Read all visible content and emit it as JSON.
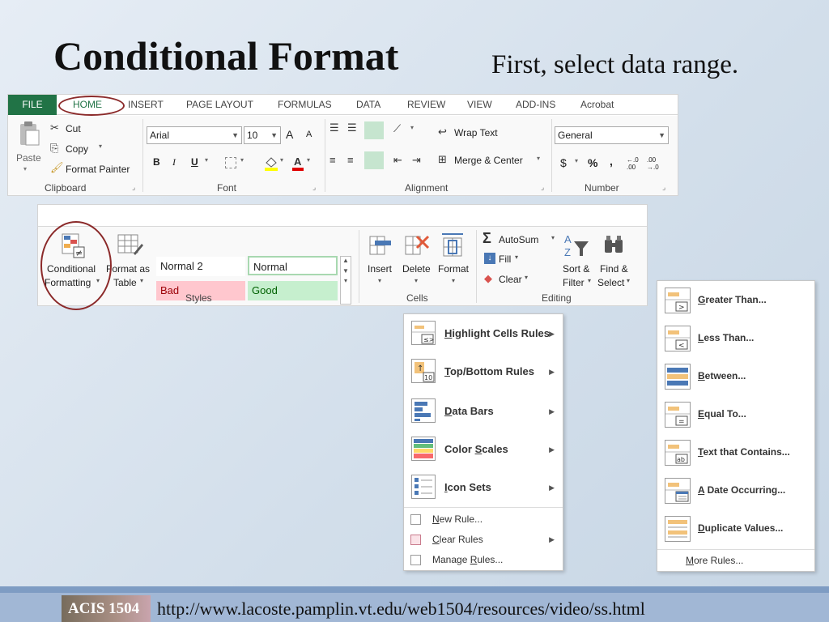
{
  "slide": {
    "title": "Conditional Format",
    "subtitle": "First, select data range."
  },
  "ribbon_top": {
    "tabs": [
      "FILE",
      "HOME",
      "INSERT",
      "PAGE LAYOUT",
      "FORMULAS",
      "DATA",
      "REVIEW",
      "VIEW",
      "ADD-INS",
      "Acrobat"
    ],
    "active_tab": "HOME",
    "clipboard": {
      "paste": "Paste",
      "cut": "Cut",
      "copy": "Copy",
      "format_painter": "Format Painter",
      "group": "Clipboard"
    },
    "font": {
      "name": "Arial",
      "size": "10",
      "bold": "B",
      "italic": "I",
      "underline": "U",
      "grow": "A",
      "shrink": "A",
      "group": "Font"
    },
    "alignment": {
      "wrap_text": "Wrap Text",
      "merge_center": "Merge & Center",
      "group": "Alignment"
    },
    "number": {
      "format": "General",
      "currency": "$",
      "percent": "%",
      "comma": ",",
      "inc_decimal": "←.0 .00",
      "dec_decimal": ".00 →.0",
      "group": "Number"
    }
  },
  "ribbon_second": {
    "conditional_formatting": [
      "Conditional",
      "Formatting"
    ],
    "format_as_table": [
      "Format as",
      "Table"
    ],
    "styles": {
      "cells": [
        "Normal 2",
        "Normal",
        "Bad",
        "Good"
      ],
      "group": "Styles"
    },
    "cells_group": {
      "insert": "Insert",
      "delete": "Delete",
      "format": "Format",
      "group": "Cells"
    },
    "editing": {
      "autosum": "AutoSum",
      "fill": "Fill",
      "clear": "Clear",
      "sort_filter": [
        "Sort &",
        "Filter"
      ],
      "find_select": [
        "Find &",
        "Select"
      ],
      "group": "Editing"
    }
  },
  "cf_menu": {
    "items": [
      {
        "label": "Highlight Cells Rules",
        "accel": "H",
        "rest": "ighlight Cells Rules"
      },
      {
        "label": "Top/Bottom Rules",
        "accel": "T",
        "rest": "op/Bottom Rules"
      },
      {
        "label": "Data Bars",
        "accel": "D",
        "rest": "ata Bars"
      },
      {
        "label": "Color Scales",
        "pre": "Color ",
        "accel": "S",
        "rest": "cales"
      },
      {
        "label": "Icon Sets",
        "accel": "I",
        "rest": "con Sets"
      }
    ],
    "new_rule": {
      "accel": "N",
      "rest": "ew Rule..."
    },
    "clear_rules": {
      "accel": "C",
      "rest": "lear Rules"
    },
    "manage_rules": {
      "pre": "Manage ",
      "accel": "R",
      "rest": "ules..."
    }
  },
  "highlight_submenu": {
    "items": [
      {
        "accel": "G",
        "rest": "reater Than...",
        "icon": "greater-than-icon"
      },
      {
        "accel": "L",
        "rest": "ess Than...",
        "icon": "less-than-icon"
      },
      {
        "accel": "B",
        "rest": "etween...",
        "icon": "between-icon"
      },
      {
        "accel": "E",
        "rest": "qual To...",
        "icon": "equal-to-icon"
      },
      {
        "accel": "T",
        "rest": "ext that Contains...",
        "icon": "text-contains-icon"
      },
      {
        "accel": "A",
        "rest": " Date Occurring...",
        "icon": "date-occurring-icon"
      },
      {
        "accel": "D",
        "rest": "uplicate Values...",
        "icon": "duplicate-values-icon"
      }
    ],
    "more_rules": {
      "accel": "M",
      "rest": "ore Rules..."
    }
  },
  "footer": {
    "logo_text": "ACIS 1504",
    "url": "http://www.lacoste.pamplin.vt.edu/web1504/resources/video/ss.html"
  },
  "colors": {
    "excel_green": "#217346",
    "annotation_oval": "#8b2a2a",
    "bad_fill": "#ffc7ce",
    "good_fill": "#c6efce",
    "footer_band": "#a1b7d5"
  }
}
